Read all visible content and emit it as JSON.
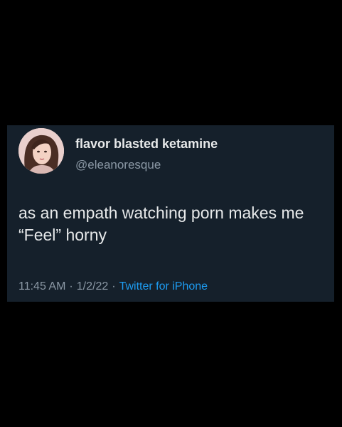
{
  "tweet": {
    "display_name": "flavor blasted ketamine",
    "handle": "@eleanoresque",
    "text": "as an empath watching porn makes me “Feel” horny",
    "time": "11:45 AM",
    "separator": "·",
    "date": "1/2/22",
    "source": "Twitter for iPhone"
  },
  "colors": {
    "background": "#000000",
    "card": "#15202b",
    "primary_text": "#e7e9ea",
    "secondary_text": "#8b98a5",
    "link": "#1d9bf0"
  },
  "icons": {
    "avatar": "profile-photo"
  }
}
